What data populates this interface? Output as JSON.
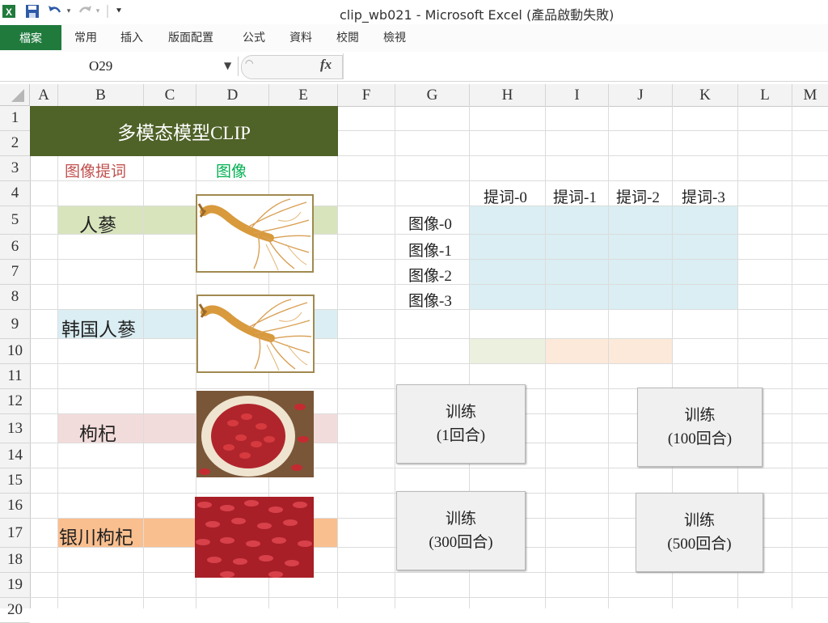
{
  "window": {
    "title": "clip_wb021 - Microsoft Excel (產品啟動失敗)"
  },
  "quick_access": {
    "excel_icon": "excel-icon",
    "save_icon": "save-icon",
    "undo_icon": "undo-icon",
    "redo_icon": "redo-icon",
    "customize_icon": "customize-icon"
  },
  "ribbon": {
    "file_tab": "檔案",
    "tabs": [
      "常用",
      "插入",
      "版面配置",
      "公式",
      "資料",
      "校閱",
      "檢視"
    ]
  },
  "formula_bar": {
    "name_box": "O29",
    "fx_label": "fx",
    "formula": ""
  },
  "columns": [
    "A",
    "B",
    "C",
    "D",
    "E",
    "F",
    "G",
    "H",
    "I",
    "J",
    "K",
    "L",
    "M"
  ],
  "rows": [
    "1",
    "2",
    "3",
    "4",
    "5",
    "6",
    "7",
    "8",
    "9",
    "10",
    "11",
    "12",
    "13",
    "14",
    "15",
    "16",
    "17",
    "18",
    "19",
    "20"
  ],
  "sheet": {
    "banner_title": "多模态模型CLIP",
    "banner_color": "#4f6228",
    "prompt_header": "图像提词",
    "prompt_header_color": "#c0504d",
    "image_header": "图像",
    "image_header_color": "#00b050",
    "prompts": [
      {
        "label": "人蔘",
        "color": "#d8e4bc"
      },
      {
        "label": "韩国人蔘",
        "color": "#daeef3"
      },
      {
        "label": "枸杞",
        "color": "#f2dcdb"
      },
      {
        "label": "银川枸杞",
        "color": "#fabf8f"
      }
    ],
    "images": [
      {
        "icon": "ginseng-image"
      },
      {
        "icon": "ginseng-image"
      },
      {
        "icon": "goji-bowl-image"
      },
      {
        "icon": "goji-berries-image"
      }
    ],
    "matrix": {
      "col_headers": [
        "提词-0",
        "提词-1",
        "提词-2",
        "提词-3"
      ],
      "row_headers": [
        "图像-0",
        "图像-1",
        "图像-2",
        "图像-3"
      ],
      "fill_color": "#daeef3"
    },
    "row10_fills": {
      "h": "#ebf1de",
      "ij": "#fde9d9"
    }
  },
  "buttons": [
    {
      "line1": "训练",
      "line2": "(1回合)"
    },
    {
      "line1": "训练",
      "line2": "(100回合)"
    },
    {
      "line1": "训练",
      "line2": "(300回合)"
    },
    {
      "line1": "训练",
      "line2": "(500回合)"
    }
  ]
}
